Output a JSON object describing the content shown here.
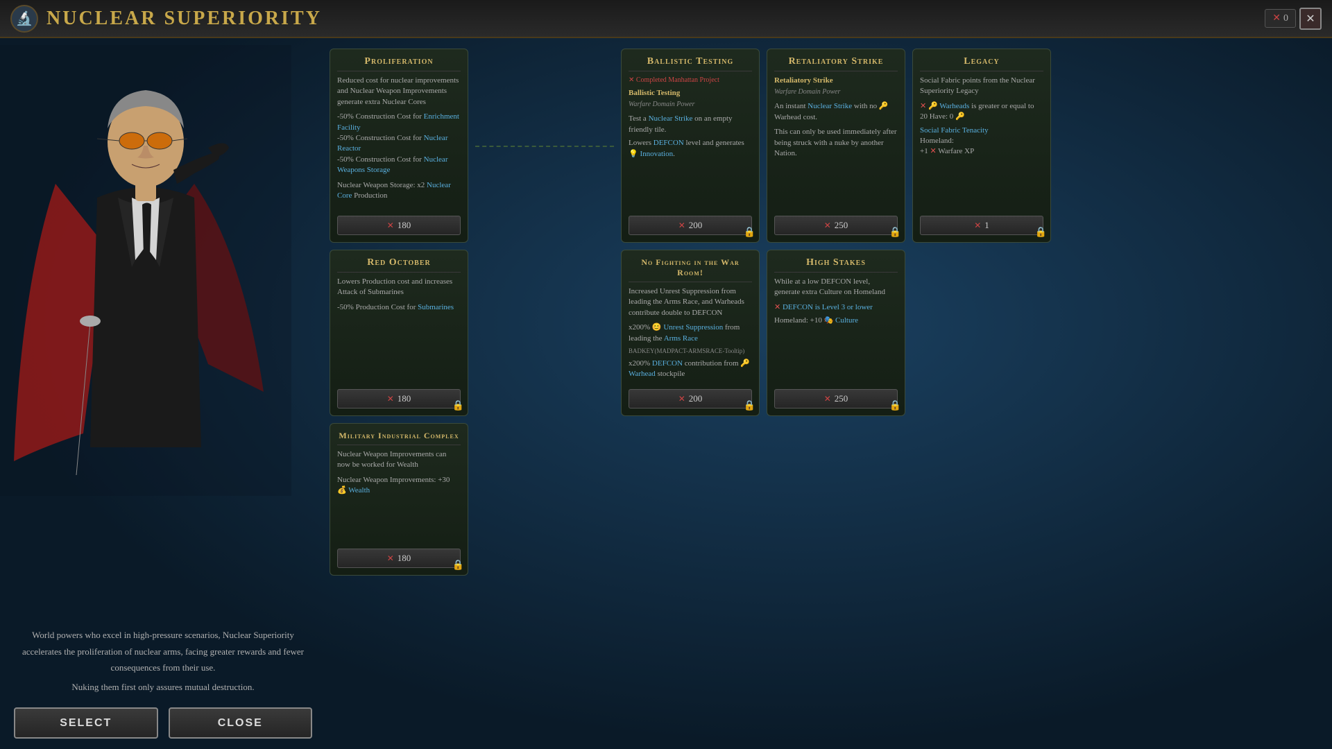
{
  "titleBar": {
    "title": "Nuclear Superiority",
    "currency": "0",
    "closeLabel": "✕"
  },
  "description": {
    "line1": "World powers who excel in high-pressure scenarios, Nuclear Superiority",
    "line2": "accelerates the proliferation of nuclear arms, facing greater rewards and fewer",
    "line3": "consequences from their use.",
    "line4": "",
    "line5": "Nuking them first only assures mutual destruction."
  },
  "buttons": {
    "select": "Select",
    "close": "Close"
  },
  "cards": {
    "proliferation": {
      "title": "Proliferation",
      "desc": "Reduced cost for nuclear improvements and Nuclear Weapon Improvements generate extra Nuclear Cores",
      "bonuses": [
        "-50% Construction Cost for Enrichment Facility",
        "-50% Construction Cost for Nuclear Reactor",
        "-50% Construction Cost for Nuclear Weapons Storage"
      ],
      "extra": "Nuclear Weapon Storage: x2 Nuclear Core Production",
      "cost": "180"
    },
    "redOctober": {
      "title": "Red October",
      "desc": "Lowers Production cost and increases Attack of Submarines",
      "bonuses": [
        "-50% Production Cost for Submarines"
      ],
      "cost": "180"
    },
    "militaryIndustrial": {
      "title": "Military Industrial Complex",
      "desc": "Nuclear Weapon Improvements can now be worked for Wealth",
      "bonuses": [
        "Nuclear Weapon Improvements: +30 💰 Wealth"
      ],
      "cost": "180"
    },
    "ballisticTesting": {
      "title": "Ballistic Testing",
      "subtitle": "Warfare Domain Power",
      "prereq": "✕ Completed Manhattan Project",
      "desc": "Test a Nuclear Strike on an empty friendly tile.",
      "effects": [
        "Lowers DEFCON level and generates 💡 Innovation."
      ],
      "cost": "200"
    },
    "noFighting": {
      "title": "No Fighting in the War Room!",
      "desc": "Increased Unrest Suppression from leading the Arms Race, and Warheads contribute double to DEFCON",
      "effects": [
        "x200% 😊 Unrest Suppression from leading the Arms Race",
        "BADKEY(MADPACT-ARMSRACE-Tooltip)",
        "x200% DEFCON contribution from 🔑 Warhead stockpile"
      ],
      "cost": "200"
    },
    "retaliatory": {
      "title": "Retaliatory Strike",
      "subtitle": "Warfare Domain Power",
      "desc": "Retaliatory Strike",
      "subdesc": "Warfare Domain Power",
      "body": "An instant Nuclear Strike with no 🔑 Warhead cost.",
      "extra": "This can only be used immediately after being struck with a nuke by another Nation.",
      "cost": "250"
    },
    "highStakes": {
      "title": "High Stakes",
      "desc": "While at a low DEFCON level, generate extra Culture on Homeland",
      "prereq": "✕ DEFCON is Level 3 or lower",
      "effects": [
        "Homeland: +10 🎭 Culture"
      ],
      "cost": "250"
    },
    "legacy": {
      "title": "Legacy",
      "desc": "Social Fabric points from the Nuclear Superiority Legacy",
      "prereq": "✕ 🔑 Warheads is greater or equal to 20 Have: 0 🔑",
      "effects": [
        "Social Fabric Tenacity",
        "Homeland:",
        "+1 ✕ Warfare XP"
      ],
      "cost": "1"
    }
  }
}
